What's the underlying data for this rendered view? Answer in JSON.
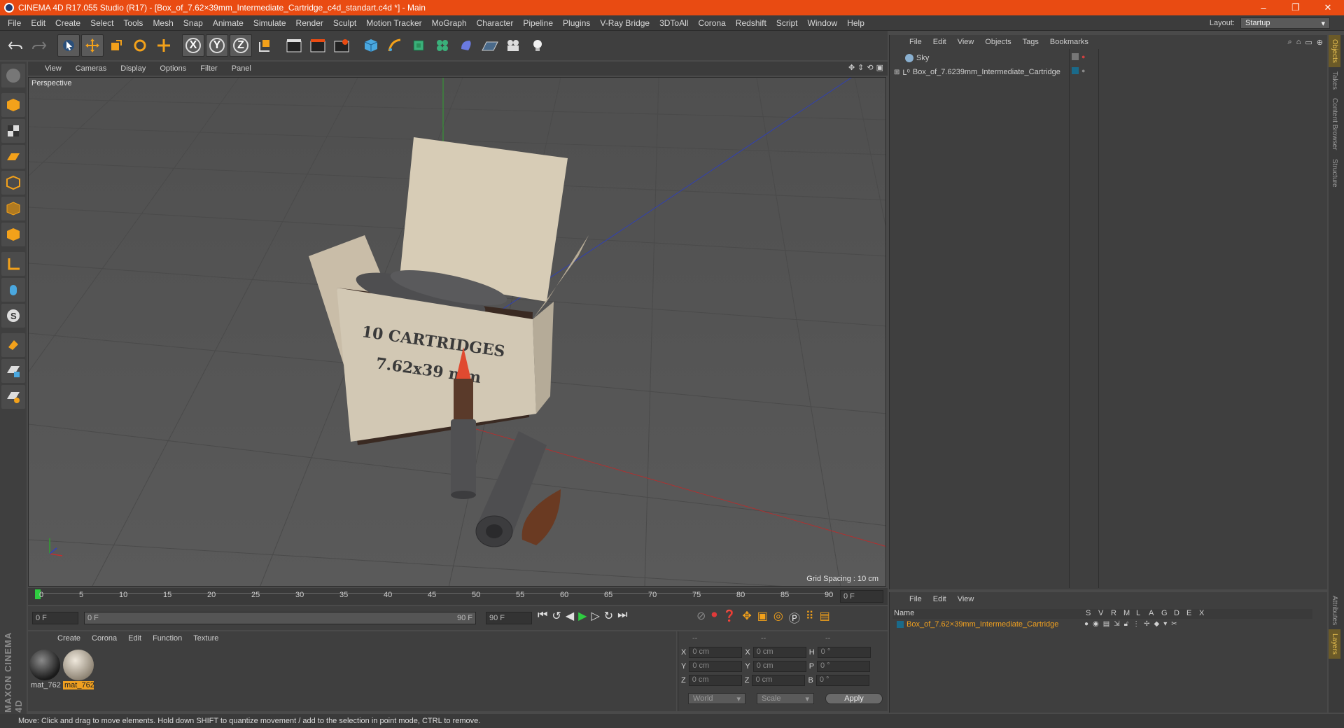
{
  "titlebar": {
    "title": "CINEMA 4D R17.055 Studio (R17) - [Box_of_7.62×39mm_Intermediate_Cartridge_c4d_standart.c4d *] - Main",
    "min": "–",
    "max": "❐",
    "close": "✕"
  },
  "menubar": {
    "items": [
      "File",
      "Edit",
      "Create",
      "Select",
      "Tools",
      "Mesh",
      "Snap",
      "Animate",
      "Simulate",
      "Render",
      "Sculpt",
      "Motion Tracker",
      "MoGraph",
      "Character",
      "Pipeline",
      "Plugins",
      "V-Ray Bridge",
      "3DToAll",
      "Corona",
      "Redshift",
      "Script",
      "Window",
      "Help"
    ],
    "layout_label": "Layout:",
    "layout_value": "Startup"
  },
  "toolbar": {
    "icons": [
      "undo-icon",
      "redo-icon",
      "select-icon",
      "move-icon",
      "scale-icon",
      "rotate-icon",
      "transform-icon",
      "x-axis-icon",
      "y-axis-icon",
      "z-axis-icon",
      "coordinate-system-icon",
      "render-view-icon",
      "render-picture-viewer-icon",
      "edit-render-settings-icon",
      "cube-icon",
      "pen-icon",
      "subdivision-icon",
      "mograph-cloner-icon",
      "deformer-icon",
      "floor-icon",
      "camera-icon",
      "light-icon"
    ],
    "x_label": "X",
    "y_label": "Y",
    "z_label": "Z"
  },
  "viewport": {
    "menu": [
      "View",
      "Cameras",
      "Display",
      "Options",
      "Filter",
      "Panel"
    ],
    "label": "Perspective",
    "grid_spacing": "Grid Spacing : 10 cm",
    "box_text_1": "10 CARTRIDGES",
    "box_text_2": "7.62x39 mm"
  },
  "timeline": {
    "ticks": [
      "0",
      "5",
      "10",
      "15",
      "20",
      "25",
      "30",
      "35",
      "40",
      "45",
      "50",
      "55",
      "60",
      "65",
      "70",
      "75",
      "80",
      "85",
      "90"
    ],
    "current_frame": "0 F"
  },
  "transport": {
    "start": "0 F",
    "range_start": "0 F",
    "range_end": "90 F",
    "end": "90 F"
  },
  "materials": {
    "menu": [
      "Create",
      "Corona",
      "Edit",
      "Function",
      "Texture"
    ],
    "items": [
      {
        "name": "mat_762",
        "selected": false
      },
      {
        "name": "mat_762",
        "selected": true
      }
    ]
  },
  "coordinates": {
    "head": [
      "--",
      "--",
      "--"
    ],
    "rows": [
      {
        "a": "X",
        "av": "0 cm",
        "b": "X",
        "bv": "0 cm",
        "c": "H",
        "cv": "0 °"
      },
      {
        "a": "Y",
        "av": "0 cm",
        "b": "Y",
        "bv": "0 cm",
        "c": "P",
        "cv": "0 °"
      },
      {
        "a": "Z",
        "av": "0 cm",
        "b": "Z",
        "bv": "0 cm",
        "c": "B",
        "cv": "0 °"
      }
    ],
    "world": "World",
    "scale": "Scale",
    "apply": "Apply"
  },
  "objects": {
    "menu": [
      "File",
      "Edit",
      "View",
      "Objects",
      "Tags",
      "Bookmarks"
    ],
    "items": [
      {
        "name": "Sky"
      },
      {
        "name": "Box_of_7.6239mm_Intermediate_Cartridge"
      }
    ]
  },
  "layers": {
    "menu": [
      "File",
      "Edit",
      "View"
    ],
    "header_name": "Name",
    "header_flags": [
      "S",
      "V",
      "R",
      "M",
      "L",
      "A",
      "G",
      "D",
      "E",
      "X"
    ],
    "row": "Box_of_7.62×39mm_Intermediate_Cartridge"
  },
  "righttabs": [
    "Objects",
    "Takes",
    "Content Browser",
    "Structure"
  ],
  "righttabs_bottom": [
    "Attributes",
    "Layers"
  ],
  "maxon": "MAXON CINEMA 4D",
  "status": "Move: Click and drag to move elements. Hold down SHIFT to quantize movement / add to the selection in point mode, CTRL to remove.",
  "colors": {
    "accent": "#e94b12",
    "selected_text": "#f0a020",
    "x_axis": "#c03030",
    "y_axis": "#30a030",
    "z_axis": "#3040c0"
  }
}
